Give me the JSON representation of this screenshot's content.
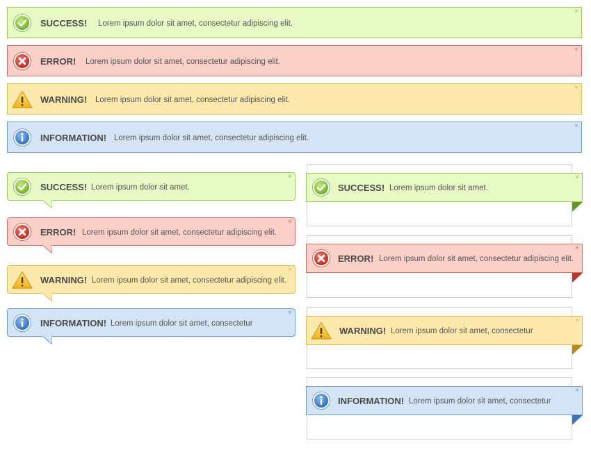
{
  "top_bars": [
    {
      "type": "success",
      "title": "SUCCESS!",
      "text": "Lorem ipsum dolor sit amet, consectetur adipiscing elit.",
      "icon": "check-icon",
      "close": "×"
    },
    {
      "type": "error",
      "title": "ERROR!",
      "text": "Lorem ipsum dolor sit amet, consectetur adipiscing elit.",
      "icon": "cross-icon",
      "close": "×"
    },
    {
      "type": "warning",
      "title": "WARNING!",
      "text": "Lorem ipsum dolor sit amet, consectetur adipiscing elit.",
      "icon": "warning-triangle-icon",
      "close": "×"
    },
    {
      "type": "info",
      "title": "INFORMATION!",
      "text": "Lorem ipsum dolor sit amet, consectetur adipiscing elit.",
      "icon": "info-icon",
      "close": "×"
    }
  ],
  "bubbles": [
    {
      "type": "success",
      "title": "SUCCESS!",
      "text": "Lorem ipsum dolor sit amet.",
      "close": "×"
    },
    {
      "type": "error",
      "title": "ERROR!",
      "text": "Lorem ipsum dolor sit amet, consectetur adipiscing elit.",
      "close": "×"
    },
    {
      "type": "warning",
      "title": "WARNING!",
      "text": "Lorem ipsum dolor sit amet, consectetur adipiscing elit.",
      "close": "×"
    },
    {
      "type": "info",
      "title": "INFORMATION!",
      "text": "Lorem ipsum dolor sit amet, consectetur",
      "close": "×"
    }
  ],
  "ribbons": [
    {
      "type": "success",
      "title": "SUCCESS!",
      "text": "Lorem ipsum dolor sit amet.",
      "close": "×"
    },
    {
      "type": "error",
      "title": "ERROR!",
      "text": "Lorem ipsum dolor sit amet, consectetur adipiscing elit.",
      "close": "×"
    },
    {
      "type": "warning",
      "title": "WARNING!",
      "text": "Lorem ipsum dolor sit amet, consectetur",
      "close": "×"
    },
    {
      "type": "info",
      "title": "INFORMATION!",
      "text": "Lorem ipsum dolor sit amet, consectetur",
      "close": "×"
    }
  ],
  "colors": {
    "success": "#e7f9c4",
    "error": "#fbd0c9",
    "warning": "#fde9ac",
    "info": "#d4e4f4",
    "success_fold": "#5f9a1e",
    "error_fold": "#b8332a",
    "warning_fold": "#b58a1a",
    "info_fold": "#3a76bd"
  }
}
